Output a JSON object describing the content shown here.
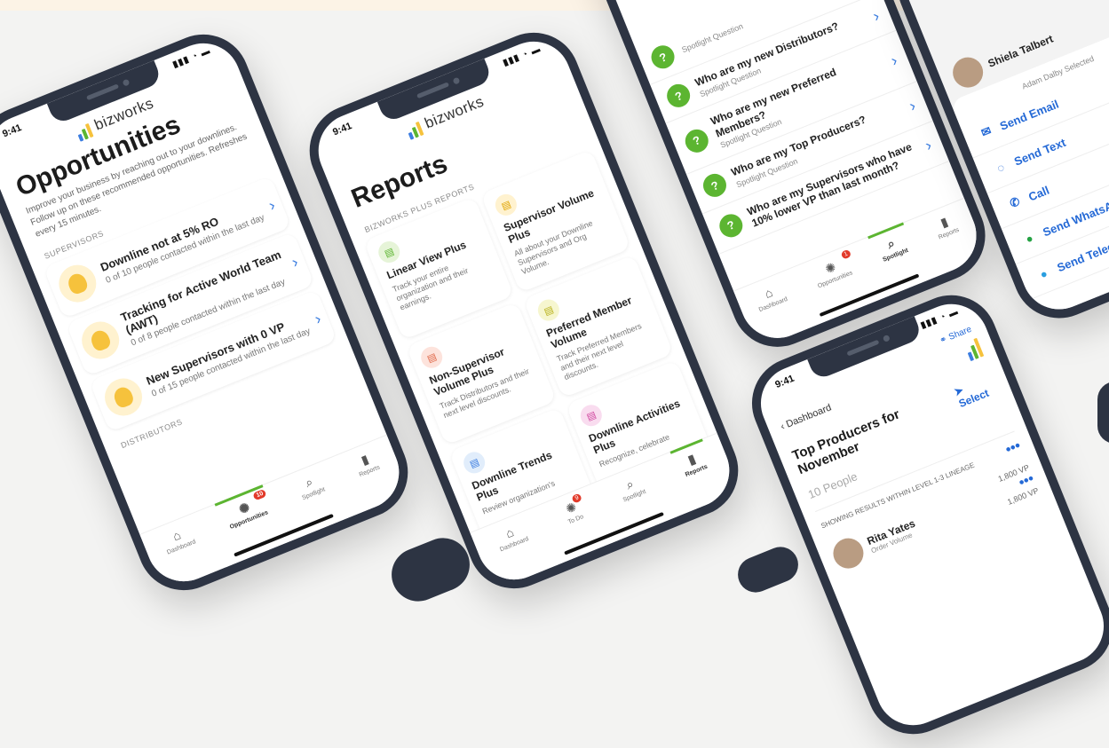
{
  "opportunities": {
    "time": "9:41",
    "brand": "bizworks",
    "title": "Opportunities",
    "description": "Improve your business by reaching out to your downlines. Follow up on these recommended opportunities. Refreshes every 15 minutes.",
    "section_supervisors": "SUPERVISORS",
    "section_distributors": "DISTRIBUTORS",
    "items": [
      {
        "title": "Downline not at 5% RO",
        "sub": "0 of 10 people contacted within the last day"
      },
      {
        "title": "Tracking for Active World Team (AWT)",
        "sub": "0 of 8 people contacted within the last day"
      },
      {
        "title": "New Supervisors with 0 VP",
        "sub": "0 of 15 people contacted within the last day"
      }
    ],
    "tabs": {
      "dashboard": "Dashboard",
      "opportunities": "Opportunities",
      "opp_badge": "10",
      "spotlight": "Spotlight",
      "reports": "Reports"
    }
  },
  "reports": {
    "time": "9:41",
    "brand": "bizworks",
    "title": "Reports",
    "section": "BIZWORKS PLUS REPORTS",
    "cards": [
      {
        "title": "Linear View Plus",
        "desc": "Track your entire organization and their earnings.",
        "color": "#e6f4d8",
        "fg": "#5cb531"
      },
      {
        "title": "Supervisor Volume Plus",
        "desc": "All about your Downline Supervisors and Org Volume.",
        "color": "#fff2cf",
        "fg": "#e0a400"
      },
      {
        "title": "Non-Supervisor Volume Plus",
        "desc": "Track Distributors and their next level discounts.",
        "color": "#fde3dc",
        "fg": "#e0694a"
      },
      {
        "title": "Preferred Member Volume",
        "desc": "Track Preferred Members and their next level discounts.",
        "color": "#f6f6cf",
        "fg": "#b9b21c"
      },
      {
        "title": "Downline Trends Plus",
        "desc": "Review organization's",
        "color": "#e1edfb",
        "fg": "#3b7de0"
      },
      {
        "title": "Downline Activities Plus",
        "desc": "Recognize, celebrate",
        "color": "#f9dcef",
        "fg": "#d0479f"
      }
    ],
    "tabs": {
      "dashboard": "Dashboard",
      "todo": "To Do",
      "todo_badge": "9",
      "spotlight": "Spotlight",
      "reports": "Reports"
    }
  },
  "spotlight": {
    "partial_top": "Spotlight Question",
    "items": [
      {
        "title": "Who are my new Distributors?",
        "sub": "Spotlight Question"
      },
      {
        "title": "Who are my new Preferred Members?",
        "sub": "Spotlight Question"
      },
      {
        "title": "Who are my Top Producers?",
        "sub": "Spotlight Question"
      },
      {
        "title": "Who are my Supervisors who have 10% lower VP than last month?",
        "sub": ""
      }
    ],
    "tabs": {
      "dashboard": "Dashboard",
      "opportunities": "Opportunities",
      "opp_badge": "1",
      "spotlight": "Spotlight",
      "reports": "Reports"
    }
  },
  "contact": {
    "name": "Shiela Talbert",
    "selected": "Adam Dalby Selected",
    "actions": [
      "Send Email",
      "Send Text",
      "Call",
      "Send WhatsApp",
      "Send Telegram"
    ]
  },
  "producers": {
    "time": "9:41",
    "back": "Dashboard",
    "share": "Share",
    "title": "Top Producers for November",
    "select": "Select",
    "count": "10 People",
    "showing": "SHOWING RESULTS WITHIN LEVEL 1-3 LINEAGE",
    "person": {
      "name": "Rita Yates",
      "vp": "1,800 VP",
      "sub": "Order Volume",
      "vp2": "1,800 VP"
    }
  }
}
